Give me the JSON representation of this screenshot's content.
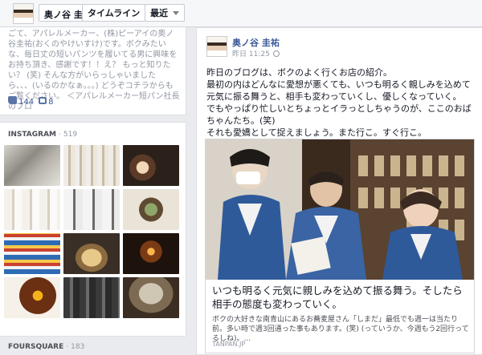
{
  "topbar": {
    "name": "奥ノ谷 圭祐",
    "timeline_label": "タイムライン",
    "recent_label": "最近"
  },
  "left_post": {
    "text": "ごて、アパレルメーカー、(株)ピーアイの奥ノ谷圭祐(おくのやけいすけ)です。ボクみたいな、毎日丈の短いパンツを履いてる男に興味をお持ち頂き、感謝です！！え？ もっと知りたい？ (笑) そんな方がいらっしゃいましたら、、、(いるのかなぁ。。。) どうぞコチラからもご覧ください。 ＜アパレルメーカー短パン社長のブロ",
    "likes": "144",
    "comments": "8"
  },
  "instagram": {
    "title": "INSTAGRAM",
    "count": "· 519"
  },
  "foursquare": {
    "title": "FOURSQUARE",
    "count": "· 183"
  },
  "post": {
    "author": "奥ノ谷 圭祐",
    "time": "昨日 11:25",
    "lines": [
      "昨日のブログは、ボクのよく行くお店の紹介。",
      "最初の内はどんなに愛想が悪くても、いつも明るく親しみを込めて元気に振る舞うと、相手も変わっていくし、優しくなっていく。",
      "でもやっぱり忙しいとちょっとイラっとしちゃうのが、ここのおばちゃんたち。(笑)",
      "それも愛嬌として捉えましょう。また行こ。すぐ行こ。"
    ],
    "link": {
      "title": "いつも明るく元気に親しみを込めて振る舞う。そしたら相手の態度も変わっていく。",
      "description": "ボクの大好きな南青山にあるお蕎麦屋さん「しまだ」最低でも週一は当たり前。多い時で週3回通った事もあります。(笑) (っていうか、今週もう2回行ってるしね)。...",
      "domain": "TANPAN.JP"
    }
  }
}
